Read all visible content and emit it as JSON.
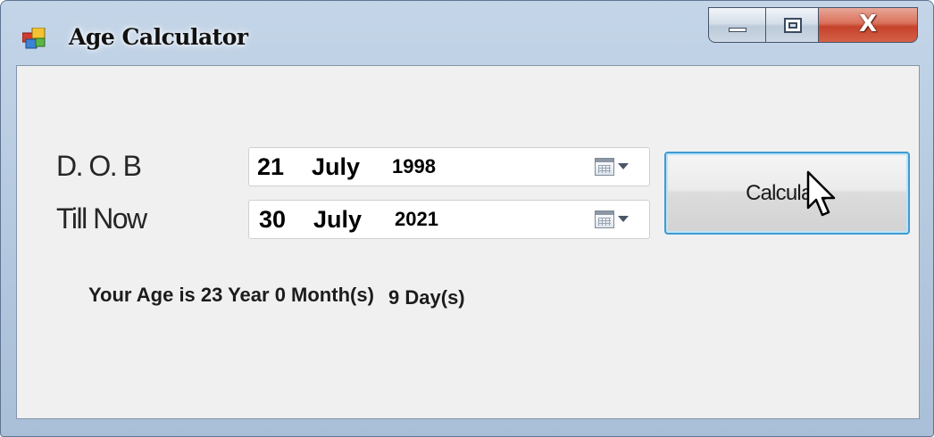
{
  "window": {
    "title": "Age Calculator",
    "controls": {
      "close_glyph": "X"
    }
  },
  "form": {
    "dob_label": "D. O. B",
    "till_label": "Till Now",
    "dob": {
      "day": "21",
      "month": "July",
      "year": "1998"
    },
    "till": {
      "day": "30",
      "month": "July",
      "year": "2021"
    },
    "calculate_label": "Calculate"
  },
  "result": {
    "main": "Your Age is 23 Year 0 Month(s)",
    "days": "9 Day(s)"
  },
  "icons": {
    "app": "app-icon",
    "calendar": "calendar-icon",
    "dropdown": "chevron-down-icon",
    "minimize": "minimize-icon",
    "maximize": "maximize-icon",
    "close": "close-icon",
    "cursor": "mouse-cursor-icon"
  },
  "colors": {
    "close_button": "#c5432a",
    "button_focus": "#3c9bd4",
    "client_bg": "#f0f0f0"
  }
}
